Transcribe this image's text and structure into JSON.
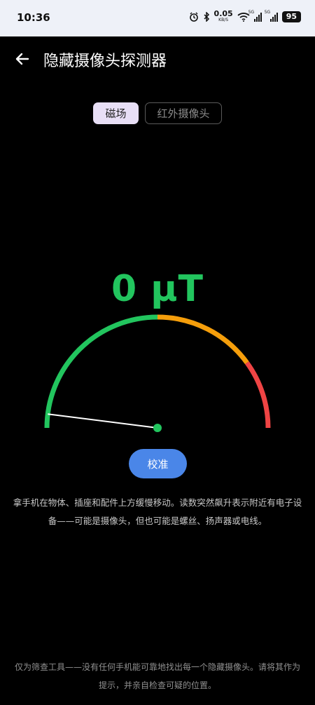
{
  "status_bar": {
    "time": "10:36",
    "net_speed": "0.05",
    "net_unit": "KB/S",
    "signal1_tag": "5G",
    "signal2_tag": "5G",
    "battery": "95"
  },
  "header": {
    "title": "隐藏摄像头探测器",
    "back_icon": "arrow-left-icon"
  },
  "tabs": [
    {
      "label": "磁场",
      "active": true
    },
    {
      "label": "红外摄像头",
      "active": false
    }
  ],
  "meter": {
    "value": 0,
    "unit": "μT",
    "reading_text": "0 μT",
    "needle_fraction": 0.04,
    "zones": [
      {
        "color": "#22c55e",
        "range": [
          0.0,
          0.5
        ]
      },
      {
        "color": "#f59e0b",
        "range": [
          0.5,
          0.8
        ]
      },
      {
        "color": "#ef4444",
        "range": [
          0.8,
          1.0
        ]
      }
    ]
  },
  "calibrate_label": "校准",
  "instructions": "拿手机在物体、插座和配件上方缓慢移动。读数突然飙升表示附近有电子设备——可能是摄像头，但也可能是螺丝、扬声器或电线。",
  "disclaimer": "仅为筛查工具——没有任何手机能可靠地找出每一个隐藏摄像头。请将其作为提示，并亲自检查可疑的位置。",
  "colors": {
    "accent_green": "#22c55e",
    "button_blue": "#4a86e8",
    "active_tab_bg": "#e8dff6"
  }
}
